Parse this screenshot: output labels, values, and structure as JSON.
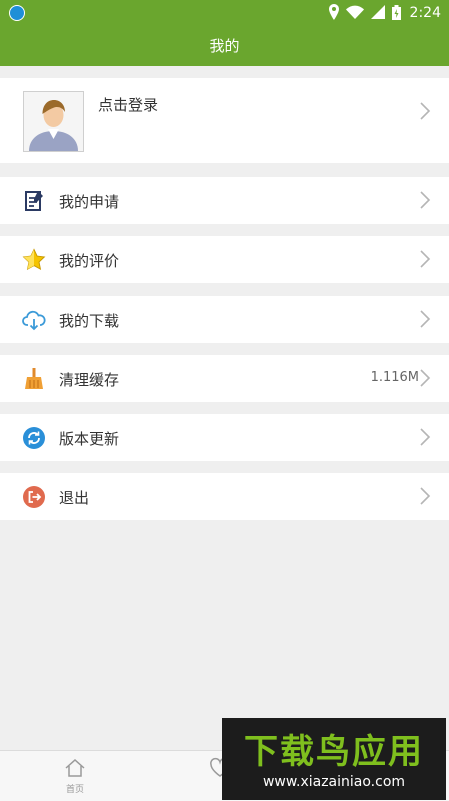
{
  "status_bar": {
    "time": "2:24"
  },
  "header": {
    "title": "我的"
  },
  "profile": {
    "login_label": "点击登录"
  },
  "menu": [
    {
      "label": "我的申请",
      "value": ""
    },
    {
      "label": "我的评价",
      "value": ""
    },
    {
      "label": "我的下载",
      "value": ""
    },
    {
      "label": "清理缓存",
      "value": "1.116M"
    },
    {
      "label": "版本更新",
      "value": ""
    },
    {
      "label": "退出",
      "value": ""
    }
  ],
  "tab_bar": {
    "tabs": [
      {
        "label": "首页"
      }
    ]
  },
  "watermark": {
    "logo_text": "下载鸟应用",
    "url": "www.xiazainiao.com"
  },
  "colors": {
    "brand_green": "#6aa62e",
    "background": "#efefef"
  }
}
